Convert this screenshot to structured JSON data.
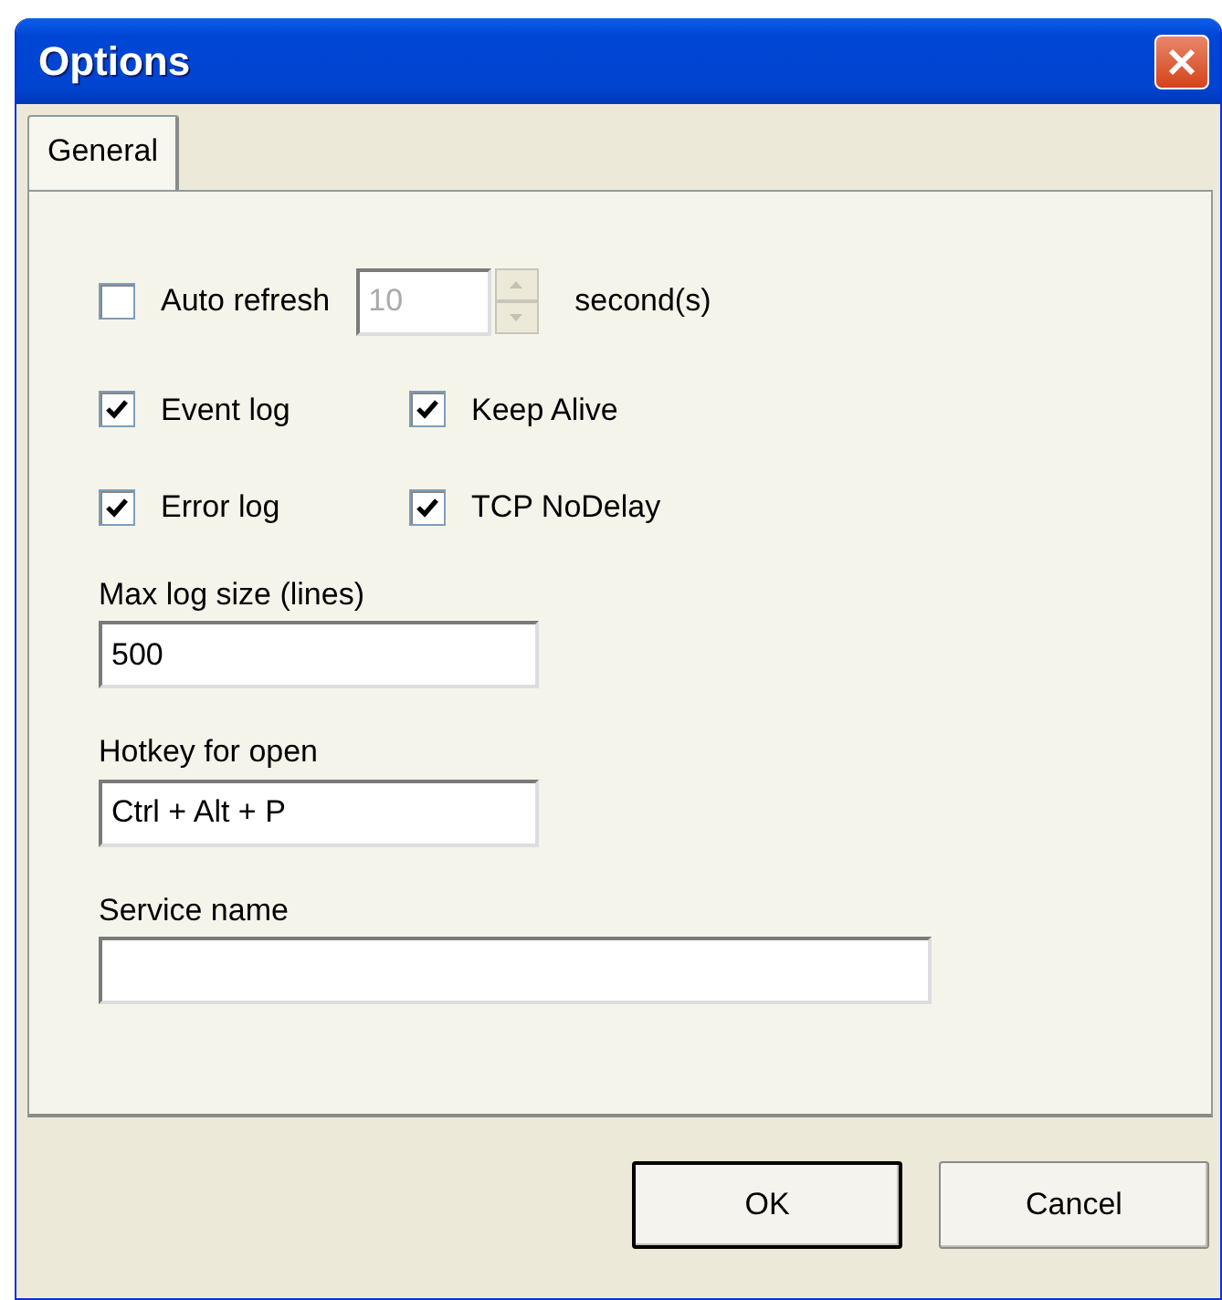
{
  "window": {
    "title": "Options"
  },
  "tabs": [
    {
      "label": "General",
      "selected": true
    }
  ],
  "auto_refresh": {
    "label": "Auto refresh",
    "checked": false,
    "interval": {
      "value": "10",
      "disabled": true
    },
    "unit": "second(s)"
  },
  "checkboxes": [
    {
      "label": "Event log",
      "checked": true
    },
    {
      "label": "Keep Alive",
      "checked": true
    },
    {
      "label": "Error log",
      "checked": true
    },
    {
      "label": "TCP NoDelay",
      "checked": true
    }
  ],
  "fields": [
    {
      "label": "Max log size (lines)",
      "value": "500",
      "wide": false
    },
    {
      "label": "Hotkey for open",
      "value": "Ctrl + Alt + P",
      "wide": false
    },
    {
      "label": "Service name",
      "wide": true
    }
  ],
  "buttons": [
    {
      "label": "OK",
      "default": true
    },
    {
      "label": "Cancel",
      "default": false
    }
  ]
}
